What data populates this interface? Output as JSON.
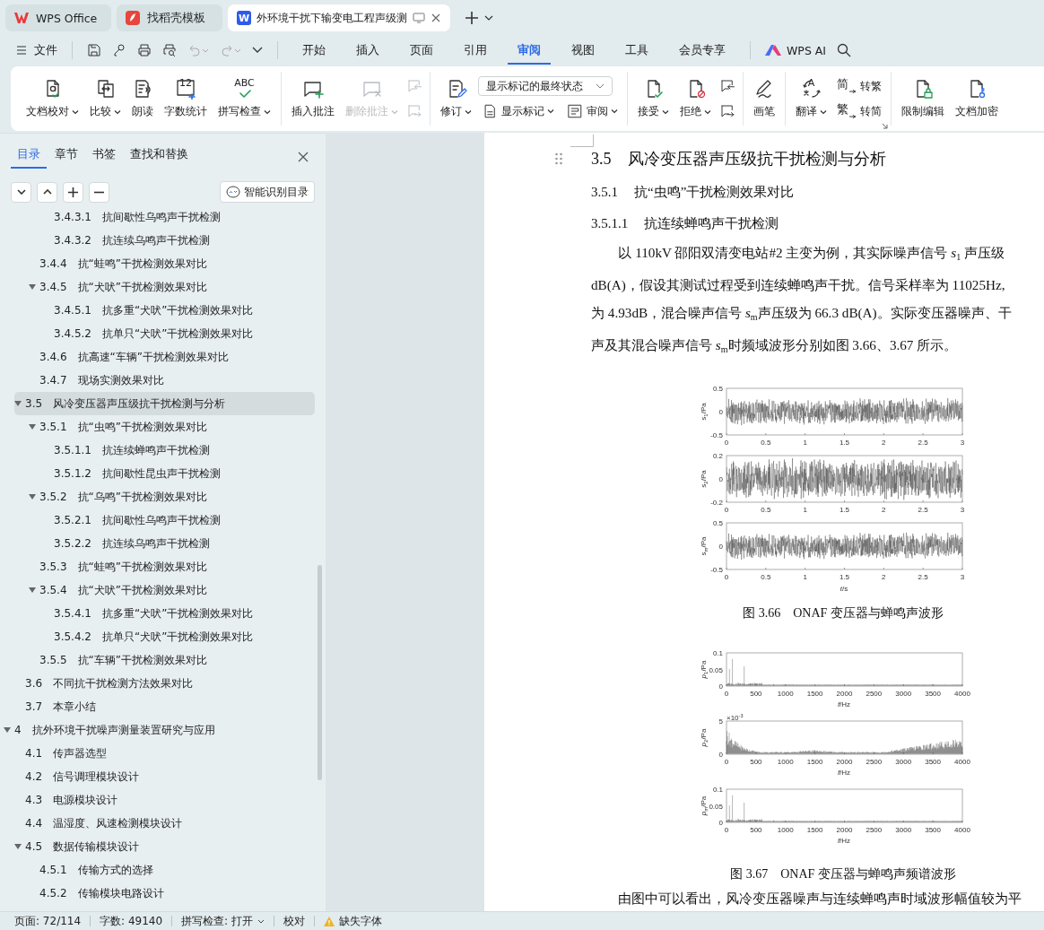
{
  "tabs": [
    {
      "label": "WPS Office",
      "selected": false
    },
    {
      "label": "找稻壳模板",
      "selected": false
    },
    {
      "label": "外环境干扰下输变电工程声级测",
      "selected": true,
      "letter": "W"
    }
  ],
  "menu": {
    "file": "文件",
    "tabs": [
      {
        "label": "开始",
        "selected": false
      },
      {
        "label": "插入",
        "selected": false
      },
      {
        "label": "页面",
        "selected": false
      },
      {
        "label": "引用",
        "selected": false
      },
      {
        "label": "审阅",
        "selected": true
      },
      {
        "label": "视图",
        "selected": false
      },
      {
        "label": "工具",
        "selected": false
      },
      {
        "label": "会员专享",
        "selected": false
      }
    ],
    "ai": "WPS AI"
  },
  "ribbon": {
    "groups": [
      {
        "items": [
          {
            "kind": "large",
            "label": "文档校对",
            "dropdown": true,
            "disabled": false
          },
          {
            "kind": "large",
            "label": "比较",
            "dropdown": true,
            "disabled": false
          },
          {
            "kind": "large",
            "label": "朗读",
            "dropdown": false,
            "disabled": false
          },
          {
            "kind": "large",
            "label": "字数统计",
            "dropdown": false,
            "disabled": false,
            "glyph": "12"
          },
          {
            "kind": "large",
            "label": "拼写检查",
            "dropdown": true,
            "disabled": false,
            "glyph": "ABC"
          }
        ]
      },
      {
        "items": [
          {
            "kind": "large",
            "label": "插入批注",
            "dropdown": false,
            "disabled": false
          },
          {
            "kind": "large",
            "label": "删除批注",
            "dropdown": true,
            "disabled": true
          },
          {
            "kind": "stack",
            "items": [
              {
                "kind": "icon",
                "disabled": true
              },
              {
                "kind": "icon",
                "disabled": true
              }
            ]
          }
        ]
      },
      {
        "items": [
          {
            "kind": "large",
            "label": "修订",
            "dropdown": true,
            "disabled": false
          },
          {
            "kind": "stack",
            "items": [
              {
                "kind": "select",
                "value": "显示标记的最终状态"
              },
              {
                "kind": "row",
                "items": [
                  {
                    "kind": "small",
                    "label": "显示标记",
                    "dropdown": true,
                    "disabled": false
                  },
                  {
                    "kind": "small",
                    "label": "审阅",
                    "dropdown": true,
                    "disabled": false
                  }
                ]
              }
            ]
          }
        ]
      },
      {
        "items": [
          {
            "kind": "large",
            "label": "接受",
            "dropdown": true,
            "disabled": false
          },
          {
            "kind": "large",
            "label": "拒绝",
            "dropdown": true,
            "disabled": false
          },
          {
            "kind": "stack",
            "items": [
              {
                "kind": "icon",
                "disabled": false
              },
              {
                "kind": "icon",
                "disabled": false
              }
            ]
          }
        ]
      },
      {
        "items": [
          {
            "kind": "large",
            "label": "画笔",
            "dropdown": false,
            "disabled": false
          }
        ]
      },
      {
        "items": [
          {
            "kind": "large",
            "label": "翻译",
            "dropdown": true,
            "disabled": false,
            "glyph": "A"
          },
          {
            "kind": "stack",
            "items": [
              {
                "kind": "small",
                "label": "转繁",
                "dropdown": false,
                "disabled": false,
                "glyph": "简"
              },
              {
                "kind": "small",
                "label": "转简",
                "dropdown": false,
                "disabled": false,
                "glyph": "繁"
              }
            ]
          }
        ]
      },
      {
        "items": [
          {
            "kind": "large",
            "label": "限制编辑",
            "dropdown": false,
            "disabled": false
          },
          {
            "kind": "large",
            "label": "文档加密",
            "dropdown": false,
            "disabled": false
          }
        ]
      }
    ]
  },
  "sidebar": {
    "tabs": [
      {
        "label": "目录",
        "selected": true
      },
      {
        "label": "章节",
        "selected": false
      },
      {
        "label": "书签",
        "selected": false
      },
      {
        "label": "查找和替换",
        "selected": false
      }
    ],
    "smart_button": "智能识别目录",
    "toc": [
      {
        "children": [
          {
            "children": [
              {
                "children": [
                  {
                    "number": "3.4.3.1",
                    "title": "抗间歇性乌鸣声干扰检测",
                    "selected": false
                  },
                  {
                    "number": "3.4.3.2",
                    "title": "抗连续乌鸣声干扰检测",
                    "selected": false
                  }
                ]
              },
              {
                "number": "3.4.4",
                "title": "抗“蛙鸣”干扰检测效果对比",
                "selected": false
              },
              {
                "number": "3.4.5",
                "title": "抗“犬吠”干扰检测效果对比",
                "selected": false,
                "expanded": true,
                "children": [
                  {
                    "number": "3.4.5.1",
                    "title": "抗多重“犬吠”干扰检测效果对比",
                    "selected": false
                  },
                  {
                    "number": "3.4.5.2",
                    "title": "抗单只“犬吠”干扰检测效果对比",
                    "selected": false
                  }
                ]
              },
              {
                "number": "3.4.6",
                "title": "抗高速“车辆”干扰检测效果对比",
                "selected": false
              },
              {
                "number": "3.4.7",
                "title": "现场实测效果对比",
                "selected": false
              }
            ]
          },
          {
            "number": "3.5",
            "title": "风冷变压器声压级抗干扰检测与分析",
            "selected": true,
            "expanded": true,
            "children": [
              {
                "number": "3.5.1",
                "title": "抗“虫鸣”干扰检测效果对比",
                "selected": false,
                "expanded": true,
                "children": [
                  {
                    "number": "3.5.1.1",
                    "title": "抗连续蝉鸣声干扰检测",
                    "selected": false
                  },
                  {
                    "number": "3.5.1.2",
                    "title": "抗间歇性昆虫声干扰检测",
                    "selected": false
                  }
                ]
              },
              {
                "number": "3.5.2",
                "title": "抗“乌鸣”干扰检测效果对比",
                "selected": false,
                "expanded": true,
                "children": [
                  {
                    "number": "3.5.2.1",
                    "title": "抗间歇性乌鸣声干扰检测",
                    "selected": false
                  },
                  {
                    "number": "3.5.2.2",
                    "title": "抗连续乌鸣声干扰检测",
                    "selected": false
                  }
                ]
              },
              {
                "number": "3.5.3",
                "title": "抗“蛙鸣”干扰检测效果对比",
                "selected": false
              },
              {
                "number": "3.5.4",
                "title": "抗“犬吠”干扰检测效果对比",
                "selected": false,
                "expanded": true,
                "children": [
                  {
                    "number": "3.5.4.1",
                    "title": "抗多重“犬吠”干扰检测效果对比",
                    "selected": false
                  },
                  {
                    "number": "3.5.4.2",
                    "title": "抗单只“犬吠”干扰检测效果对比",
                    "selected": false
                  }
                ]
              },
              {
                "number": "3.5.5",
                "title": "抗“车辆”干扰检测效果对比",
                "selected": false
              }
            ]
          },
          {
            "number": "3.6",
            "title": "不同抗干扰检测方法效果对比",
            "selected": false
          },
          {
            "number": "3.7",
            "title": "本章小结",
            "selected": false
          }
        ]
      },
      {
        "number": "4",
        "title": "抗外环境干扰噪声测量装置研究与应用",
        "selected": false,
        "expanded": true,
        "children": [
          {
            "number": "4.1",
            "title": "传声器选型",
            "selected": false
          },
          {
            "number": "4.2",
            "title": "信号调理模块设计",
            "selected": false
          },
          {
            "number": "4.3",
            "title": "电源模块设计",
            "selected": false
          },
          {
            "number": "4.4",
            "title": "温湿度、风速检测模块设计",
            "selected": false
          },
          {
            "number": "4.5",
            "title": "数据传输模块设计",
            "selected": false,
            "expanded": true,
            "children": [
              {
                "number": "4.5.1",
                "title": "传输方式的选择",
                "selected": false
              },
              {
                "number": "4.5.2",
                "title": "传输模块电路设计",
                "selected": false
              }
            ]
          }
        ]
      }
    ]
  },
  "document": {
    "blocks": [
      {
        "kind": "section",
        "number": "3.5",
        "title": "风冷变压器声压级抗干扰检测与分析"
      },
      {
        "kind": "subsection",
        "number": "3.5.1",
        "title": "抗“虫鸣”干扰检测效果对比"
      },
      {
        "kind": "subsubsection",
        "number": "3.5.1.1",
        "title": "抗连续蝉鸣声干扰检测"
      },
      {
        "kind": "paragraph",
        "lines": [
          "以 110kV 邵阳双清变电站#2 主变为例，其实际噪声信号 *s*$_{1}$ 声压级",
          "dB(A)，假设其测试过程受到连续蝉鸣声干扰。信号采样率为 11025Hz,",
          "为 4.93dB，混合噪声信号 *s*$_{m}$声压级为 66.3 dB(A)。实际变压器噪声、干",
          "声及其混合噪声信号 *s*$_{m}$时频域波形分别如图 3.66、3.67 所示。"
        ]
      },
      {
        "kind": "figure",
        "caption": "图 3.66　ONAF 变压器与蝉鸣声波形",
        "panels": [
          {
            "kind": "noise",
            "ylabel": {
              "symbol": "s",
              "sub": "1",
              "unit": "/Pa"
            },
            "yticks": [
              "0.5",
              "0",
              "-0.5"
            ],
            "xticks": [
              "0",
              "0.5",
              "1",
              "1.5",
              "2",
              "2.5",
              "3"
            ]
          },
          {
            "kind": "dense-noise",
            "ylabel": {
              "symbol": "s",
              "sub": "2",
              "unit": "/Pa"
            },
            "yticks": [
              "0.2",
              "0",
              "-0.2"
            ],
            "xticks": [
              "0",
              "0.5",
              "1",
              "1.5",
              "2",
              "2.5",
              "3"
            ]
          },
          {
            "kind": "noise",
            "ylabel": {
              "symbol": "s",
              "sub": "m",
              "unit": "/Pa"
            },
            "yticks": [
              "0.5",
              "0",
              "-0.5"
            ],
            "xticks": [
              "0",
              "0.5",
              "1",
              "1.5",
              "2",
              "2.5",
              "3"
            ],
            "xlabel": {
              "symbol": "t",
              "unit": "/s"
            }
          }
        ]
      },
      {
        "kind": "figure",
        "caption": "图 3.67　ONAF 变压器与蝉鸣声频谱波形",
        "panels": [
          {
            "kind": "spikes",
            "ylabel": {
              "symbol": "p",
              "sub": "1",
              "unit": "/Pa"
            },
            "yticks": [
              "0.1",
              "0.05",
              "0"
            ],
            "xticks": [
              "0",
              "500",
              "1000",
              "1500",
              "2000",
              "2500",
              "3000",
              "3500",
              "4000"
            ],
            "xlabel": {
              "symbol": "f",
              "unit": "/Hz"
            }
          },
          {
            "kind": "broadband",
            "ylabel": {
              "symbol": "p",
              "sub": "2",
              "unit": "/Pa"
            },
            "scale": {
              "base": "×10",
              "power": "-3"
            },
            "yticks": [
              "5",
              "0"
            ],
            "xticks": [
              "0",
              "500",
              "1000",
              "1500",
              "2000",
              "2500",
              "3000",
              "3500",
              "4000"
            ],
            "xlabel": {
              "symbol": "f",
              "unit": "/Hz"
            }
          },
          {
            "kind": "spikes",
            "ylabel": {
              "symbol": "p",
              "sub": "m",
              "unit": "/Pa"
            },
            "yticks": [
              "0.1",
              "0.05",
              "0"
            ],
            "xticks": [
              "0",
              "500",
              "1000",
              "1500",
              "2000",
              "2500",
              "3000",
              "3500",
              "4000"
            ],
            "xlabel": {
              "symbol": "f",
              "unit": "/Hz"
            }
          }
        ]
      },
      {
        "kind": "paragraph",
        "lines": [
          "由图中可以看出，风冷变压器噪声与连续蝉鸣声时域波形幅值较为平"
        ]
      }
    ]
  },
  "status_bar": [
    {
      "kind": "text",
      "label": "页面: 72/114"
    },
    {
      "kind": "text",
      "label": "字数: 49140"
    },
    {
      "kind": "dropdown",
      "label": "拼写检查: 打开"
    },
    {
      "kind": "text",
      "label": "校对"
    },
    {
      "kind": "warning",
      "label": "缺失字体"
    }
  ]
}
